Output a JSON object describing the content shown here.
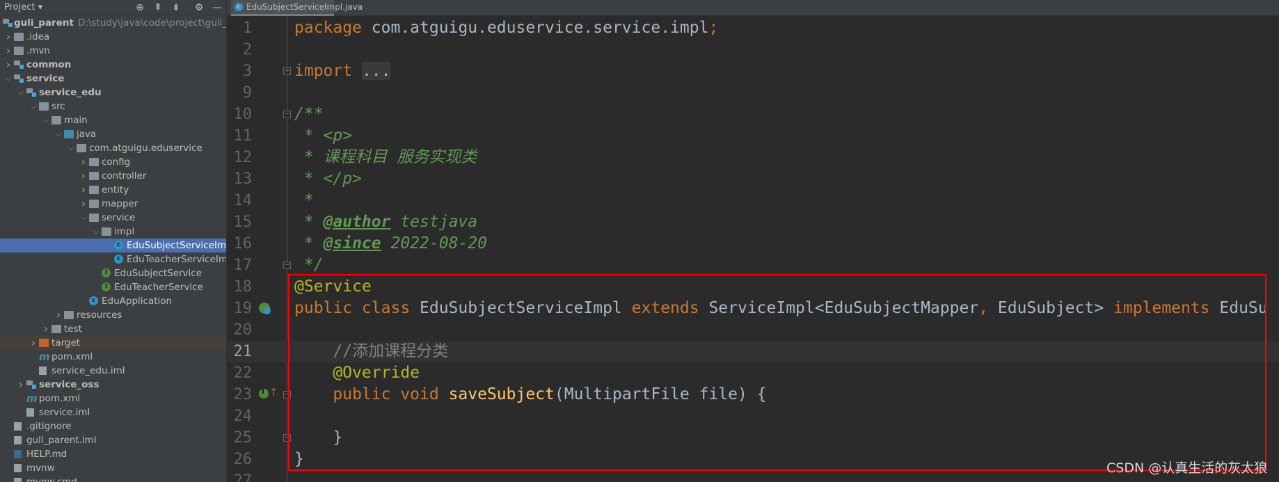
{
  "project_panel": {
    "title": "Project",
    "toolbar": [
      {
        "icon": "crosshair-icon"
      },
      {
        "icon": "expand-all-icon"
      },
      {
        "icon": "collapse-all-icon"
      },
      {
        "icon": "gear-icon"
      },
      {
        "icon": "minimize-icon"
      }
    ],
    "tree": [
      {
        "label": "guli_parent",
        "path": "D:\\study\\java\\code\\project\\guli_parent",
        "level": -1,
        "icon": "module",
        "bold": true
      },
      {
        "label": ".idea",
        "level": 0,
        "chev": "right",
        "icon": "folder"
      },
      {
        "label": ".mvn",
        "level": 0,
        "chev": "right",
        "icon": "folder"
      },
      {
        "label": "common",
        "level": 0,
        "chev": "right",
        "icon": "module",
        "bold": true
      },
      {
        "label": "service",
        "level": 0,
        "chev": "down",
        "icon": "module",
        "bold": true
      },
      {
        "label": "service_edu",
        "level": 1,
        "chev": "down",
        "icon": "module",
        "bold": true
      },
      {
        "label": "src",
        "level": 2,
        "chev": "down",
        "icon": "folder"
      },
      {
        "label": "main",
        "level": 3,
        "chev": "down",
        "icon": "folder"
      },
      {
        "label": "java",
        "level": 4,
        "chev": "down",
        "icon": "source-folder"
      },
      {
        "label": "com.atguigu.eduservice",
        "level": 5,
        "chev": "down",
        "icon": "package"
      },
      {
        "label": "config",
        "level": 6,
        "chev": "right",
        "icon": "package"
      },
      {
        "label": "controller",
        "level": 6,
        "chev": "right",
        "icon": "package"
      },
      {
        "label": "entity",
        "level": 6,
        "chev": "right",
        "icon": "package"
      },
      {
        "label": "mapper",
        "level": 6,
        "chev": "right",
        "icon": "package"
      },
      {
        "label": "service",
        "level": 6,
        "chev": "down",
        "icon": "package"
      },
      {
        "label": "impl",
        "level": 7,
        "chev": "down",
        "icon": "package"
      },
      {
        "label": "EduSubjectServiceImpl",
        "level": 8,
        "icon": "class",
        "selected": true
      },
      {
        "label": "EduTeacherServiceImpl",
        "level": 8,
        "icon": "class"
      },
      {
        "label": "EduSubjectService",
        "level": 7,
        "icon": "interface"
      },
      {
        "label": "EduTeacherService",
        "level": 7,
        "icon": "interface"
      },
      {
        "label": "EduApplication",
        "level": 6,
        "icon": "spring-app"
      },
      {
        "label": "resources",
        "level": 4,
        "chev": "right",
        "icon": "resources-folder"
      },
      {
        "label": "test",
        "level": 3,
        "chev": "right",
        "icon": "folder"
      },
      {
        "label": "target",
        "level": 2,
        "chev": "right",
        "icon": "excluded-folder",
        "highlight": true
      },
      {
        "label": "pom.xml",
        "level": 2,
        "icon": "maven"
      },
      {
        "label": "service_edu.iml",
        "level": 2,
        "icon": "iml-file"
      },
      {
        "label": "service_oss",
        "level": 1,
        "chev": "right",
        "icon": "module",
        "bold": true
      },
      {
        "label": "pom.xml",
        "level": 1,
        "icon": "maven"
      },
      {
        "label": "service.iml",
        "level": 1,
        "icon": "iml-file"
      },
      {
        "label": ".gitignore",
        "level": 0,
        "icon": "ignore-file"
      },
      {
        "label": "guli_parent.iml",
        "level": 0,
        "icon": "iml-file"
      },
      {
        "label": "HELP.md",
        "level": 0,
        "icon": "markdown-file"
      },
      {
        "label": "mvnw",
        "level": 0,
        "icon": "script-file"
      },
      {
        "label": "mvnw.cmd",
        "level": 0,
        "icon": "iml-file"
      }
    ]
  },
  "editor": {
    "tab": {
      "label": "EduSubjectServiceImpl.java",
      "close": "×"
    },
    "current_line": "21",
    "lines": [
      {
        "n": "1",
        "tokens": [
          [
            "package ",
            "kw"
          ],
          [
            "com.atguigu.eduservice.service.impl",
            "pl"
          ],
          [
            ";",
            "kw"
          ]
        ]
      },
      {
        "n": "2",
        "tokens": []
      },
      {
        "n": "3",
        "fold": "+",
        "tokens": [
          [
            "import ",
            "kw"
          ],
          [
            "...",
            "fd"
          ]
        ]
      },
      {
        "n": "9",
        "tokens": []
      },
      {
        "n": "10",
        "fold": "-",
        "tokens": [
          [
            "/**",
            "dc"
          ]
        ]
      },
      {
        "n": "11",
        "tokens": [
          [
            " * <p>",
            "dc"
          ]
        ]
      },
      {
        "n": "12",
        "tokens": [
          [
            " * 课程科目 服务实现类",
            "dc"
          ]
        ]
      },
      {
        "n": "13",
        "tokens": [
          [
            " * </p>",
            "dc"
          ]
        ]
      },
      {
        "n": "14",
        "tokens": [
          [
            " *",
            "dc"
          ]
        ]
      },
      {
        "n": "15",
        "tokens": [
          [
            " * ",
            "dc"
          ],
          [
            "@author",
            "dt"
          ],
          [
            " testjava",
            "dc"
          ]
        ]
      },
      {
        "n": "16",
        "tokens": [
          [
            " * ",
            "dc"
          ],
          [
            "@since",
            "dt"
          ],
          [
            " 2022-08-20",
            "dc"
          ]
        ]
      },
      {
        "n": "17",
        "fold": "-",
        "tokens": [
          [
            " */",
            "dc"
          ]
        ]
      },
      {
        "n": "18",
        "tokens": [
          [
            "@Service",
            "an"
          ]
        ]
      },
      {
        "n": "19",
        "gutter": "spring-bean-icon",
        "tokens": [
          [
            "public class ",
            "kw"
          ],
          [
            "EduSubjectServiceImpl ",
            "pl"
          ],
          [
            "extends ",
            "kw"
          ],
          [
            "ServiceImpl<EduSubjectMapper",
            "pl"
          ],
          [
            ", ",
            "kw"
          ],
          [
            "EduSubject> ",
            "pl"
          ],
          [
            "implements ",
            "kw"
          ],
          [
            "EduSu",
            "pl"
          ]
        ]
      },
      {
        "n": "20",
        "tokens": []
      },
      {
        "n": "21",
        "tokens": [
          [
            "    //添加课程分类",
            "cm"
          ]
        ]
      },
      {
        "n": "22",
        "tokens": [
          [
            "    @Override",
            "an"
          ]
        ]
      },
      {
        "n": "23",
        "gutter": "implements-method-icon",
        "fold": "-",
        "tokens": [
          [
            "    public void ",
            "kw"
          ],
          [
            "saveSubject",
            "fn"
          ],
          [
            "(MultipartFile file) {",
            "pl"
          ]
        ]
      },
      {
        "n": "24",
        "tokens": []
      },
      {
        "n": "25",
        "fold": "-",
        "tokens": [
          [
            "    }",
            "pl"
          ]
        ]
      },
      {
        "n": "26",
        "tokens": [
          [
            "}",
            "pl"
          ]
        ]
      },
      {
        "n": "27",
        "tokens": []
      }
    ]
  },
  "annotation_box_color": "#ff0000",
  "watermark": "CSDN @认真生活的灰太狼"
}
